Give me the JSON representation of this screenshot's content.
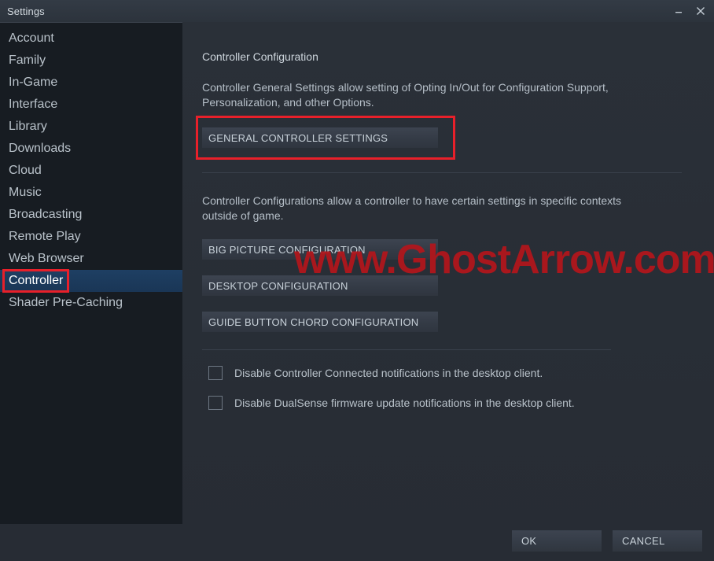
{
  "window": {
    "title": "Settings",
    "minimize_icon": "minimize-icon",
    "close_icon": "close-icon"
  },
  "sidebar": {
    "items": [
      {
        "label": "Account",
        "selected": false
      },
      {
        "label": "Family",
        "selected": false
      },
      {
        "label": "In-Game",
        "selected": false
      },
      {
        "label": "Interface",
        "selected": false
      },
      {
        "label": "Library",
        "selected": false
      },
      {
        "label": "Downloads",
        "selected": false
      },
      {
        "label": "Cloud",
        "selected": false
      },
      {
        "label": "Music",
        "selected": false
      },
      {
        "label": "Broadcasting",
        "selected": false
      },
      {
        "label": "Remote Play",
        "selected": false
      },
      {
        "label": "Web Browser",
        "selected": false
      },
      {
        "label": "Controller",
        "selected": true
      },
      {
        "label": "Shader Pre-Caching",
        "selected": false
      }
    ]
  },
  "main": {
    "section_title": "Controller Configuration",
    "description_1": "Controller General Settings allow setting of Opting In/Out for Configuration Support, Personalization, and other Options.",
    "general_button": "GENERAL CONTROLLER SETTINGS",
    "description_2": "Controller Configurations allow a controller to have certain settings in specific contexts outside of game.",
    "config_buttons": [
      "BIG PICTURE CONFIGURATION",
      "DESKTOP CONFIGURATION",
      "GUIDE BUTTON CHORD CONFIGURATION"
    ],
    "checkboxes": [
      {
        "label": "Disable Controller Connected notifications in the desktop client.",
        "checked": false
      },
      {
        "label": "Disable DualSense firmware update notifications in the desktop client.",
        "checked": false
      }
    ]
  },
  "footer": {
    "ok_label": "OK",
    "cancel_label": "CANCEL"
  },
  "overlay": {
    "watermark": "www.GhostArrow.com",
    "highlight_color": "#e8202a",
    "watermark_color": "#b3161c",
    "selection_color": "#1e3f63"
  }
}
